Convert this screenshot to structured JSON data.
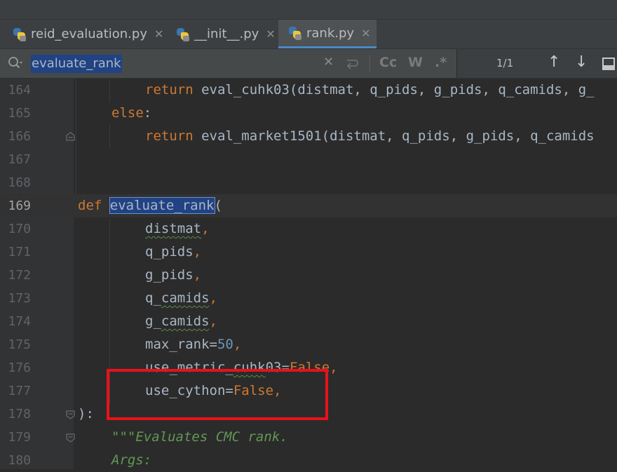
{
  "tabs": [
    {
      "label": "reid_evaluation.py",
      "close": "✕",
      "active": false,
      "icon": "python-file-icon"
    },
    {
      "label": "__init__.py",
      "close": "✕",
      "active": false,
      "icon": "python-file-icon"
    },
    {
      "label": "rank.py",
      "close": "✕",
      "active": true,
      "icon": "python-file-icon"
    }
  ],
  "search": {
    "query": "evaluate_rank",
    "clear": "✕",
    "case_label": "Cc",
    "word_label": "W",
    "regex_label": ".*",
    "match_count": "1/1",
    "prev": "↑",
    "next": "↓"
  },
  "editor": {
    "lines": [
      {
        "num": "164"
      },
      {
        "num": "165"
      },
      {
        "num": "166"
      },
      {
        "num": "167"
      },
      {
        "num": "168"
      },
      {
        "num": "169"
      },
      {
        "num": "170"
      },
      {
        "num": "171"
      },
      {
        "num": "172"
      },
      {
        "num": "173"
      },
      {
        "num": "174"
      },
      {
        "num": "175"
      },
      {
        "num": "176"
      },
      {
        "num": "177"
      },
      {
        "num": "178"
      },
      {
        "num": "179"
      },
      {
        "num": "180"
      }
    ],
    "code": {
      "l164_kw": "return",
      "l164_rest": " eval_cuhk03(distmat, q_pids, g_pids, q_camids, g_",
      "l165_kw": "else",
      "l165_rest": ":",
      "l166_kw": "return",
      "l166_rest": " eval_market1501(distmat, q_pids, g_pids, q_camids",
      "l169_kw": "def",
      "l169_fn": "evaluate_rank",
      "l169_rest": "(",
      "l170_id": "distmat",
      "l170_c": ",",
      "l171_id": "q_pids",
      "l171_c": ",",
      "l172_id": "g_pids",
      "l172_c": ",",
      "l173_a": "q_",
      "l173_b": "camids",
      "l173_c": ",",
      "l174_a": "g_",
      "l174_b": "camids",
      "l174_c": ",",
      "l175_a": "max_rank=",
      "l175_num": "50",
      "l175_c": ",",
      "l176_a": "use_metric_",
      "l176_b": "cuhk",
      "l176_c": "03=",
      "l176_kw": "False",
      "l176_d": ",",
      "l177_a": "use_cython=",
      "l177_kw": "False",
      "l177_c": ",",
      "l178": "):",
      "l179": "\"\"\"Evaluates CMC rank.",
      "l180": "Args:"
    }
  },
  "colors": {
    "keyword": "#cc7832",
    "number": "#6897bb",
    "docstring": "#629755",
    "default": "#a9b7c6",
    "selection": "#214283",
    "highlight_box": "#e8121a"
  }
}
